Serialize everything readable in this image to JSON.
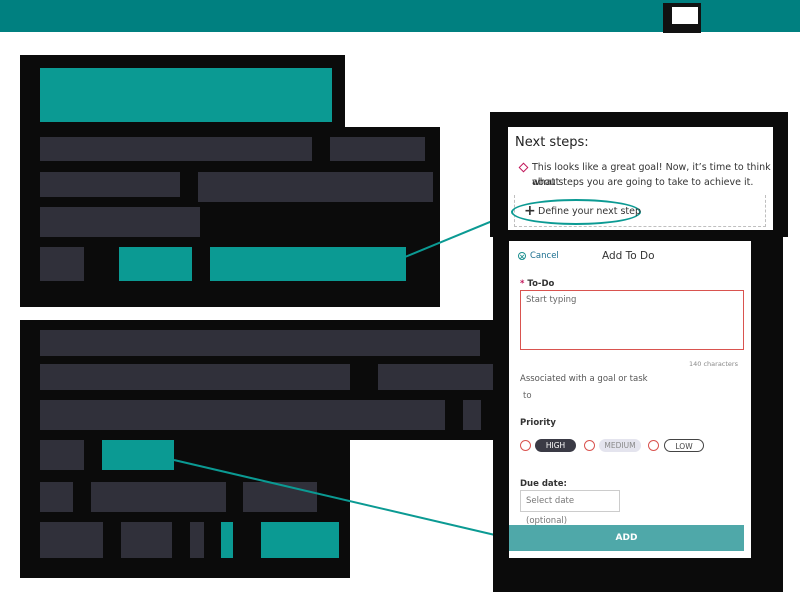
{
  "next_steps": {
    "title": "Next steps:",
    "message_line1": "This looks like a great goal! Now, it’s time to think about",
    "message_line2": "what steps you are going to take to achieve it.",
    "define_link": "Define your next step"
  },
  "add_todo": {
    "cancel_label": "Cancel",
    "title": "Add To Do",
    "todo_label": "To-Do",
    "required_mark": "*",
    "todo_placeholder": "Start typing",
    "char_count": "140 characters",
    "associated_label": "Associated with a goal or task",
    "associated_value": "to",
    "priority_label": "Priority",
    "priority_options": [
      "HIGH",
      "MEDIUM",
      "LOW"
    ],
    "due_label": "Due date:",
    "due_placeholder": "Select date (optional)",
    "add_button": "ADD"
  },
  "colors": {
    "brand_teal": "#008080",
    "highlight_teal": "#0b9a93",
    "redaction_black": "#0b0b0b",
    "redaction_bar": "#30303a",
    "add_button": "#4fa8a9",
    "error_red": "#d9534f"
  },
  "icons": {
    "define": "plus-icon",
    "message": "diamond-icon",
    "cancel": "close-circle-icon"
  }
}
